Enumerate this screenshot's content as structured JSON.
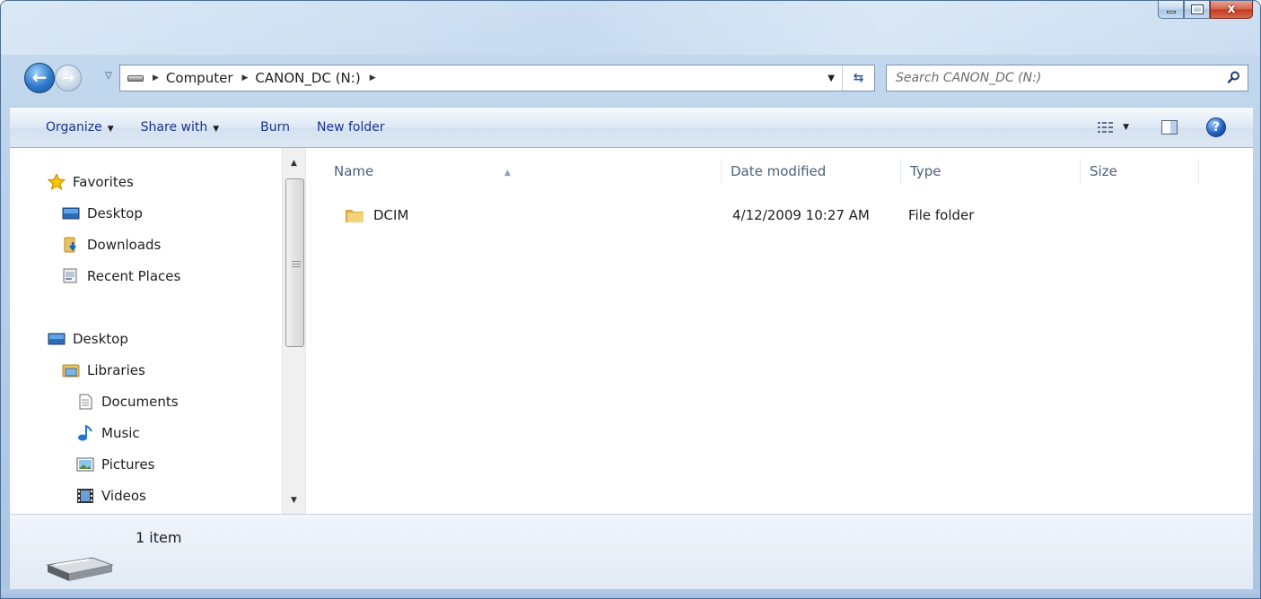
{
  "window": {
    "close_glyph": "x"
  },
  "navigation": {
    "back_glyph": "←",
    "forward_glyph": "→"
  },
  "address": {
    "crumbs": [
      "Computer",
      "CANON_DC (N:)"
    ]
  },
  "search": {
    "placeholder": "Search CANON_DC (N:)"
  },
  "toolbar": {
    "organize_label": "Organize",
    "share_with_label": "Share with",
    "burn_label": "Burn",
    "new_folder_label": "New folder",
    "help_glyph": "?"
  },
  "sidebar": {
    "favorites_label": "Favorites",
    "favorites": [
      {
        "label": "Desktop",
        "icon": "desktop-icon"
      },
      {
        "label": "Downloads",
        "icon": "downloads-icon"
      },
      {
        "label": "Recent Places",
        "icon": "recent-places-icon"
      }
    ],
    "desktop_label": "Desktop",
    "libraries_label": "Libraries",
    "libraries": [
      {
        "label": "Documents",
        "icon": "documents-icon"
      },
      {
        "label": "Music",
        "icon": "music-icon"
      },
      {
        "label": "Pictures",
        "icon": "pictures-icon"
      },
      {
        "label": "Videos",
        "icon": "videos-icon"
      }
    ]
  },
  "file_list": {
    "columns": [
      "Name",
      "Date modified",
      "Type",
      "Size"
    ],
    "rows": [
      {
        "name": "DCIM",
        "date_modified": "4/12/2009 10:27 AM",
        "type": "File folder",
        "size": ""
      }
    ]
  },
  "details": {
    "item_count": "1 item"
  },
  "colors": {
    "frame": "#b9d1ea",
    "command_text": "#1e3287",
    "header_text": "#4c607a",
    "folder_yellow": "#e8c25a"
  }
}
